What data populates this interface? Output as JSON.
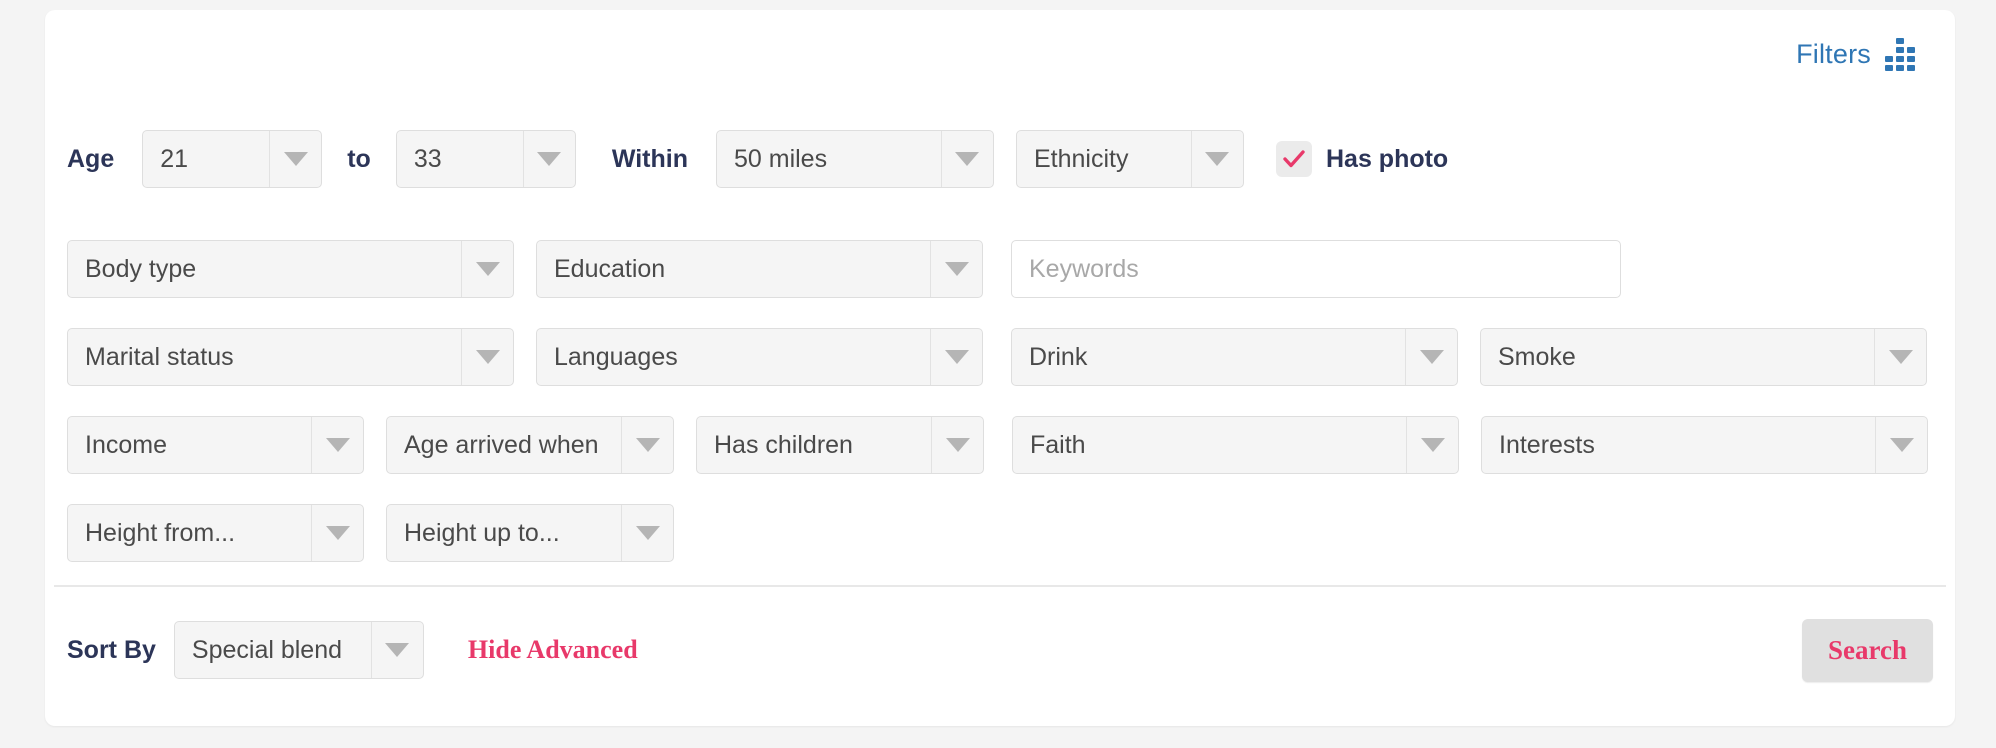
{
  "colors": {
    "accent_pink": "#e8396a",
    "link_blue": "#2f76b4",
    "label_navy": "#2c3558",
    "card_bg": "#ffffff",
    "page_bg": "#f4f4f4",
    "field_bg": "#f5f5f5"
  },
  "header": {
    "filters_label": "Filters",
    "filters_icon": "filter-grid-icon"
  },
  "row1": {
    "age_label": "Age",
    "age_from": "21",
    "age_to_label": "to",
    "age_to": "33",
    "within_label": "Within",
    "distance": "50 miles",
    "ethnicity": "Ethnicity",
    "has_photo_label": "Has photo",
    "has_photo_checked": true
  },
  "row2": {
    "body_type": "Body type",
    "education": "Education",
    "keywords_placeholder": "Keywords",
    "keywords_value": ""
  },
  "row3": {
    "marital_status": "Marital status",
    "languages": "Languages",
    "drink": "Drink",
    "smoke": "Smoke"
  },
  "row4": {
    "income": "Income",
    "age_arrived": "Age arrived when",
    "has_children": "Has children",
    "faith": "Faith",
    "interests": "Interests"
  },
  "row5": {
    "height_from": "Height from...",
    "height_up_to": "Height up to..."
  },
  "footer": {
    "sort_by_label": "Sort By",
    "sort_value": "Special blend",
    "hide_advanced": "Hide Advanced",
    "search_label": "Search"
  }
}
